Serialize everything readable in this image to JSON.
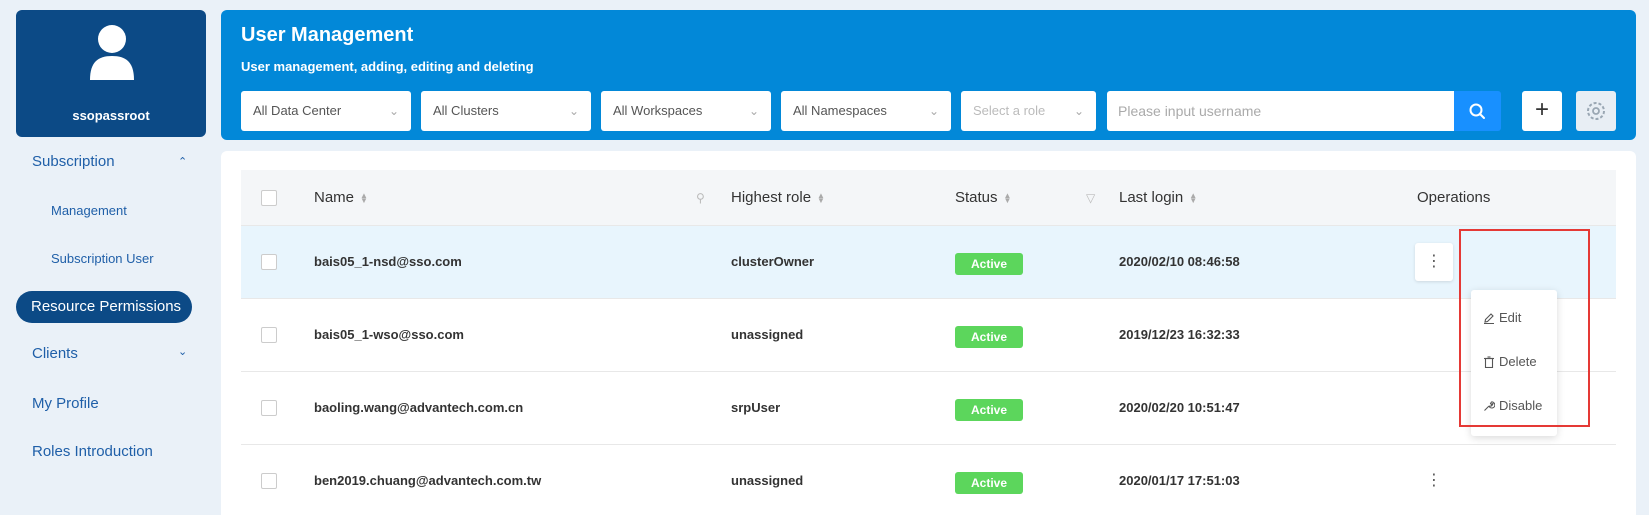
{
  "user": {
    "name": "ssopassroot"
  },
  "sidebar": {
    "items": [
      {
        "label": "Subscription",
        "icon": "chevron-up-icon"
      },
      {
        "label": "Management"
      },
      {
        "label": "Subscription User"
      },
      {
        "label": "Resource Permissions",
        "active": true
      },
      {
        "label": "Clients",
        "icon": "chevron-down-icon"
      },
      {
        "label": "My Profile"
      },
      {
        "label": "Roles Introduction"
      }
    ]
  },
  "header": {
    "title": "User Management",
    "subtitle": "User management, adding, editing and deleting",
    "filters": {
      "data_center": "All Data Center",
      "clusters": "All Clusters",
      "workspaces": "All Workspaces",
      "namespaces": "All Namespaces",
      "role": "Select a role"
    },
    "search_placeholder": "Please input username"
  },
  "table": {
    "columns": {
      "name": "Name",
      "role": "Highest role",
      "status": "Status",
      "last_login": "Last login",
      "operations": "Operations"
    },
    "rows": [
      {
        "name": "bais05_1-nsd@sso.com",
        "role": "clusterOwner",
        "status": "Active",
        "last_login": "2020/02/10 08:46:58"
      },
      {
        "name": "bais05_1-wso@sso.com",
        "role": "unassigned",
        "status": "Active",
        "last_login": "2019/12/23 16:32:33"
      },
      {
        "name": "baoling.wang@advantech.com.cn",
        "role": "srpUser",
        "status": "Active",
        "last_login": "2020/02/20 10:51:47"
      },
      {
        "name": "ben2019.chuang@advantech.com.tw",
        "role": "unassigned",
        "status": "Active",
        "last_login": "2020/01/17 17:51:03"
      }
    ]
  },
  "menu": {
    "edit": "Edit",
    "delete": "Delete",
    "disable": "Disable"
  },
  "colors": {
    "brand_dark": "#0c4a86",
    "banner": "#0288d8",
    "active_badge": "#5cd65c",
    "highlight": "#e53935"
  }
}
